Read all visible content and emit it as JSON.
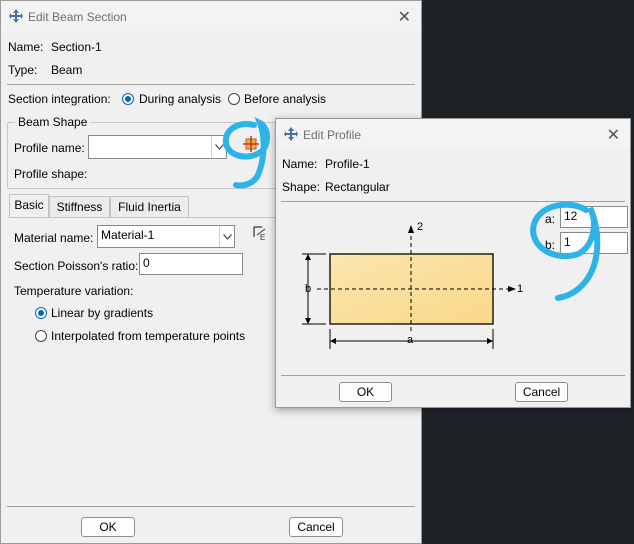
{
  "beam_dialog": {
    "title": "Edit Beam Section",
    "name_label": "Name:",
    "name_value": "Section-1",
    "type_label": "Type:",
    "type_value": "Beam",
    "integration_label": "Section integration:",
    "integration_options": [
      "During analysis",
      "Before analysis"
    ],
    "integration_selected": "During analysis",
    "beam_shape_group": "Beam Shape",
    "profile_name_label": "Profile name:",
    "profile_name_value": "",
    "profile_shape_label": "Profile shape:",
    "tabs": [
      "Basic",
      "Stiffness",
      "Fluid Inertia"
    ],
    "active_tab": "Basic",
    "material_name_label": "Material name:",
    "material_name_value": "Material-1",
    "poisson_label": "Section Poisson's ratio:",
    "poisson_value": "0",
    "temp_variation_label": "Temperature variation:",
    "temp_options": [
      "Linear by gradients",
      "Interpolated from temperature points"
    ],
    "temp_selected": "Linear by gradients",
    "ok_label": "OK",
    "cancel_label": "Cancel"
  },
  "profile_dialog": {
    "title": "Edit Profile",
    "name_label": "Name:",
    "name_value": "Profile-1",
    "shape_label": "Shape:",
    "shape_value": "Rectangular",
    "a_label": "a:",
    "a_value": "12",
    "b_label": "b:",
    "b_value": "1",
    "diagram": {
      "axis2": "2",
      "axis1": "1",
      "dim_a": "a",
      "dim_b": "b"
    },
    "ok_label": "OK",
    "cancel_label": "Cancel"
  },
  "colors": {
    "highlight": "#2db3e8",
    "radio_blue": "#0067c0",
    "rect_fill": "#fbe4a8"
  }
}
